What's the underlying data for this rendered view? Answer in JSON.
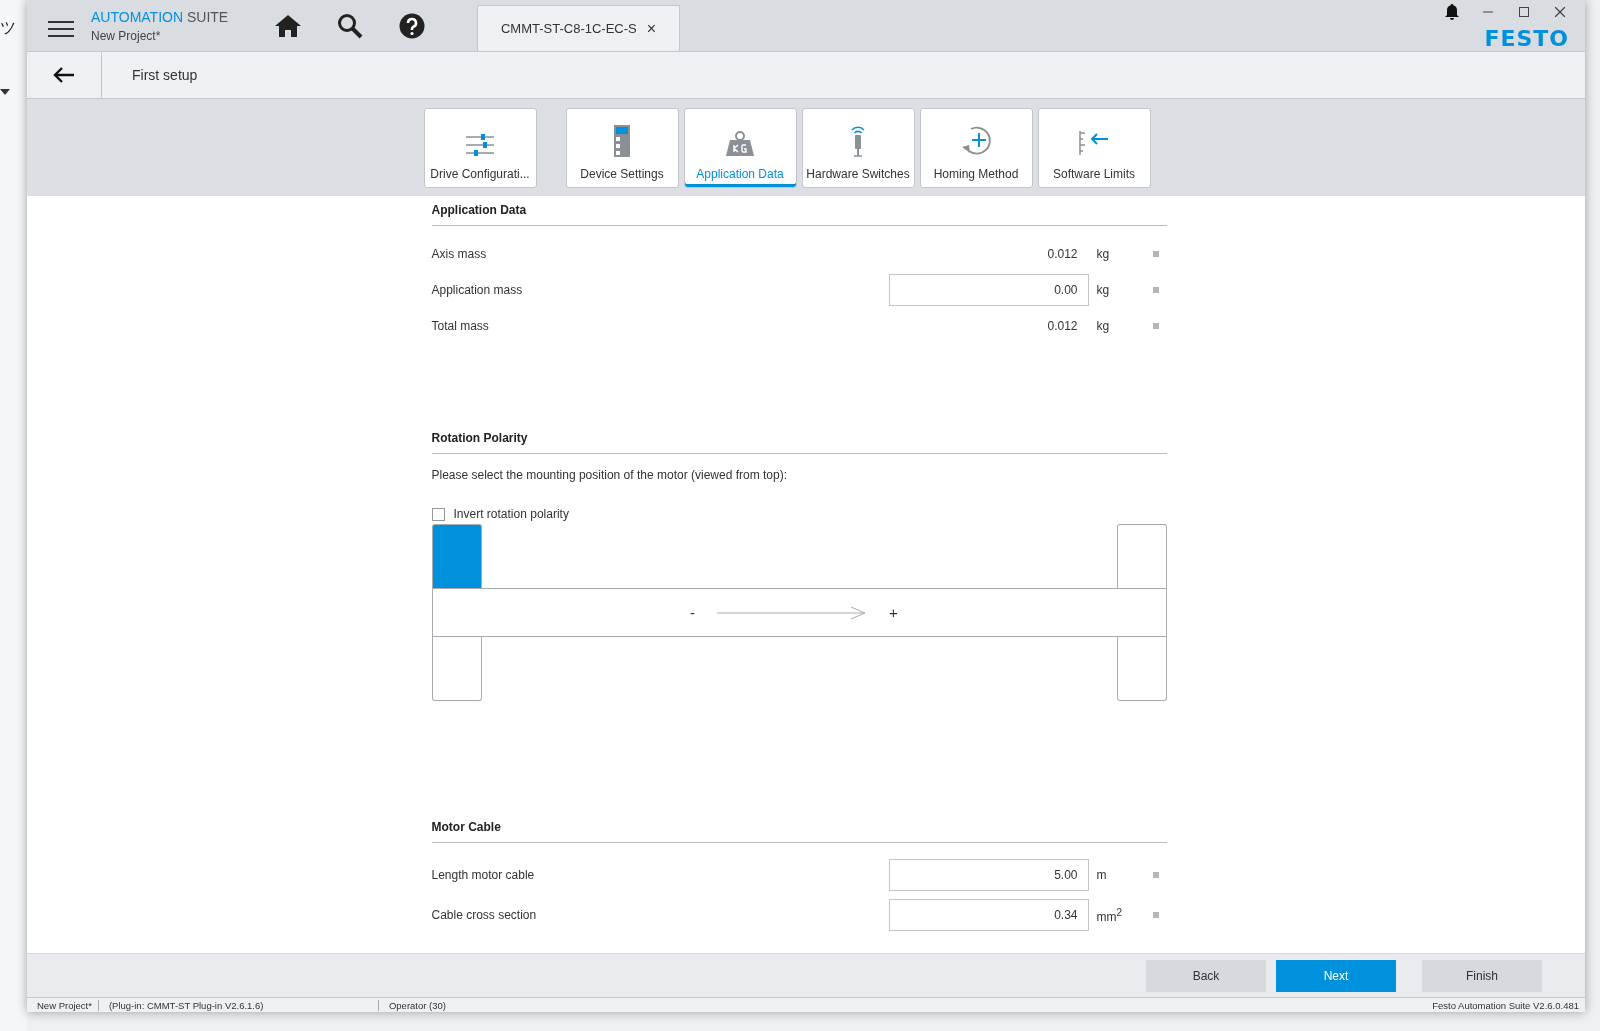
{
  "desktop": {
    "fragment": "ツ"
  },
  "window": {
    "app_title": {
      "accent": "AUTOMATION",
      "rest": "SUITE"
    },
    "project": "New Project*",
    "document_tab": {
      "label": "CMMT-ST-C8-1C-EC-S",
      "close": "×"
    },
    "logo": "FESTO"
  },
  "breadcrumb": {
    "title": "First setup"
  },
  "wizard_tabs": [
    {
      "label": "Drive Configurati...",
      "selected": false
    },
    {
      "label": "Device Settings",
      "selected": false
    },
    {
      "label": "Application Data",
      "selected": true
    },
    {
      "label": "Hardware Switches",
      "selected": false
    },
    {
      "label": "Homing Method",
      "selected": false
    },
    {
      "label": "Software Limits",
      "selected": false
    }
  ],
  "application_data": {
    "heading": "Application Data",
    "rows": [
      {
        "label": "Axis mass",
        "kind": "readonly",
        "value": "0.012",
        "unit": "kg"
      },
      {
        "label": "Application mass",
        "kind": "input",
        "value": "0.00",
        "unit": "kg"
      },
      {
        "label": "Total mass",
        "kind": "readonly",
        "value": "0.012",
        "unit": "kg"
      }
    ]
  },
  "rotation_polarity": {
    "heading": "Rotation Polarity",
    "instruction": "Please select the mounting position of the motor (viewed from top):",
    "invert": {
      "label": "Invert rotation polarity",
      "checked": false
    },
    "minus": "-",
    "plus": "+",
    "mounting_positions": [
      {
        "selected": true
      },
      {
        "selected": false
      },
      {
        "selected": false
      },
      {
        "selected": false
      }
    ]
  },
  "motor_cable": {
    "heading": "Motor Cable",
    "rows": [
      {
        "label": "Length motor cable",
        "kind": "input",
        "value": "5.00",
        "unit": "m"
      },
      {
        "label": "Cable cross section",
        "kind": "input",
        "value": "0.34",
        "unit": "mm$^{2}$"
      }
    ]
  },
  "footer_buttons": [
    {
      "label": "Back",
      "primary": false
    },
    {
      "label": "Next",
      "primary": true
    },
    {
      "label": "Finish",
      "primary": false
    }
  ],
  "status_bar": {
    "project": "New Project*",
    "plugin": "(Plug-in: CMMT-ST Plug-in V2.6.1.6)",
    "user": "Operator (30)",
    "version": "Festo Automation Suite V2.6.0.481"
  }
}
